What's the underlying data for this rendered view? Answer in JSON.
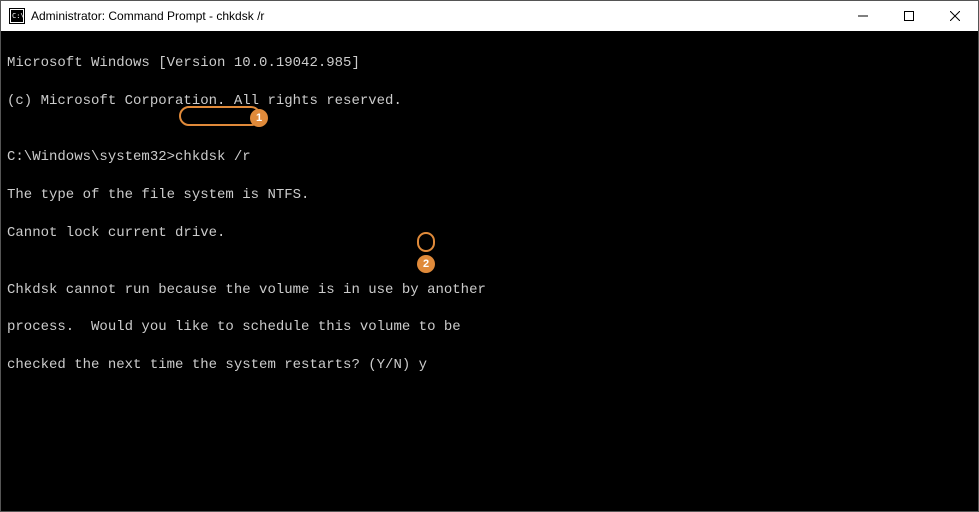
{
  "window": {
    "title": "Administrator: Command Prompt - chkdsk  /r"
  },
  "terminal": {
    "line1": "Microsoft Windows [Version 10.0.19042.985]",
    "line2": "(c) Microsoft Corporation. All rights reserved.",
    "blank1": "",
    "prompt_path": "C:\\Windows\\system32>",
    "command": "chkdsk /r",
    "line4": "The type of the file system is NTFS.",
    "line5": "Cannot lock current drive.",
    "blank2": "",
    "line6": "Chkdsk cannot run because the volume is in use by another",
    "line7": "process.  Would you like to schedule this volume to be",
    "line8_prefix": "checked the next time the system restarts? (Y/N) ",
    "response": "y"
  },
  "annotations": {
    "badge1": "1",
    "badge2": "2"
  }
}
